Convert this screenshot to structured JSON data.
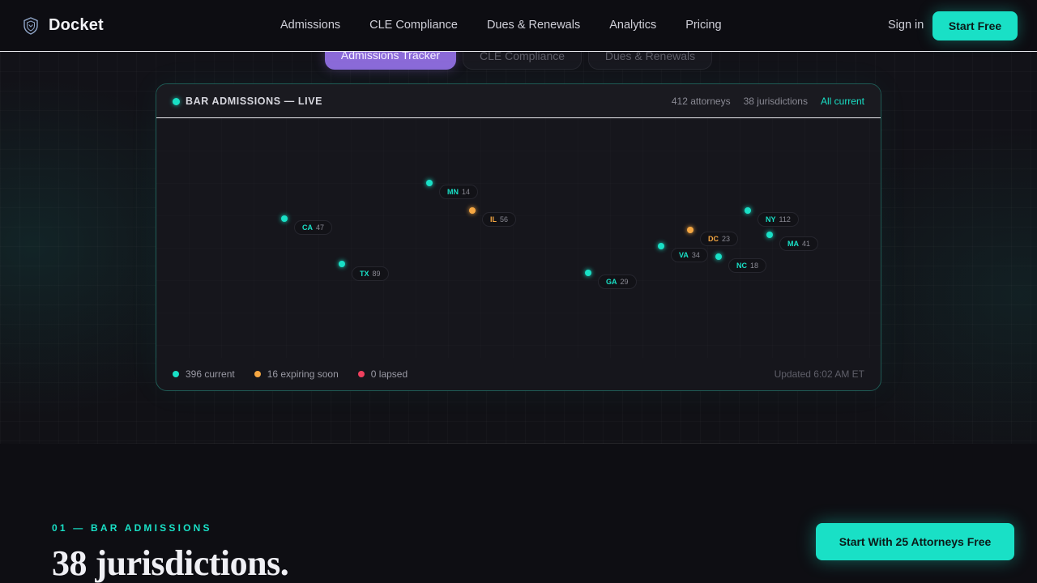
{
  "brand": {
    "name": "Docket",
    "icon": "shield-icon"
  },
  "nav": {
    "links": [
      "Admissions",
      "CLE Compliance",
      "Dues & Renewals",
      "Analytics",
      "Pricing"
    ],
    "sign_in": "Sign in",
    "start_free": "Start Free"
  },
  "tabs": [
    "Admissions Tracker",
    "CLE Compliance",
    "Dues & Renewals"
  ],
  "card": {
    "live_label": "BAR ADMISSIONS — LIVE",
    "stats": {
      "attorneys": "412 attorneys",
      "jurisdictions": "38 jurisdictions",
      "status": "All current"
    },
    "pins": [
      {
        "code": "CA",
        "count": "47",
        "status": "current"
      },
      {
        "code": "TX",
        "count": "89",
        "status": "current"
      },
      {
        "code": "MN",
        "count": "14",
        "status": "current"
      },
      {
        "code": "IL",
        "count": "56",
        "status": "expiring"
      },
      {
        "code": "GA",
        "count": "29",
        "status": "current"
      },
      {
        "code": "VA",
        "count": "34",
        "status": "current"
      },
      {
        "code": "DC",
        "count": "23",
        "status": "expiring"
      },
      {
        "code": "NC",
        "count": "18",
        "status": "current"
      },
      {
        "code": "NY",
        "count": "112",
        "status": "current"
      },
      {
        "code": "MA",
        "count": "41",
        "status": "current"
      }
    ],
    "legend": [
      {
        "label": "396 current",
        "color": "#19e0c6"
      },
      {
        "label": "16 expiring soon",
        "color": "#f5a742"
      },
      {
        "label": "0 lapsed",
        "color": "#f0405e"
      }
    ],
    "updated": "Updated 6:02 AM ET"
  },
  "colors": {
    "accent": "#19e0c6",
    "current": "#19e0c6",
    "expiring": "#f5a742",
    "lapsed": "#f0405e",
    "tab_active": "#8b6ad8"
  },
  "section": {
    "eyebrow": "01 — BAR ADMISSIONS",
    "headline": "38 jurisdictions.",
    "cta": "Start With 25 Attorneys Free"
  }
}
